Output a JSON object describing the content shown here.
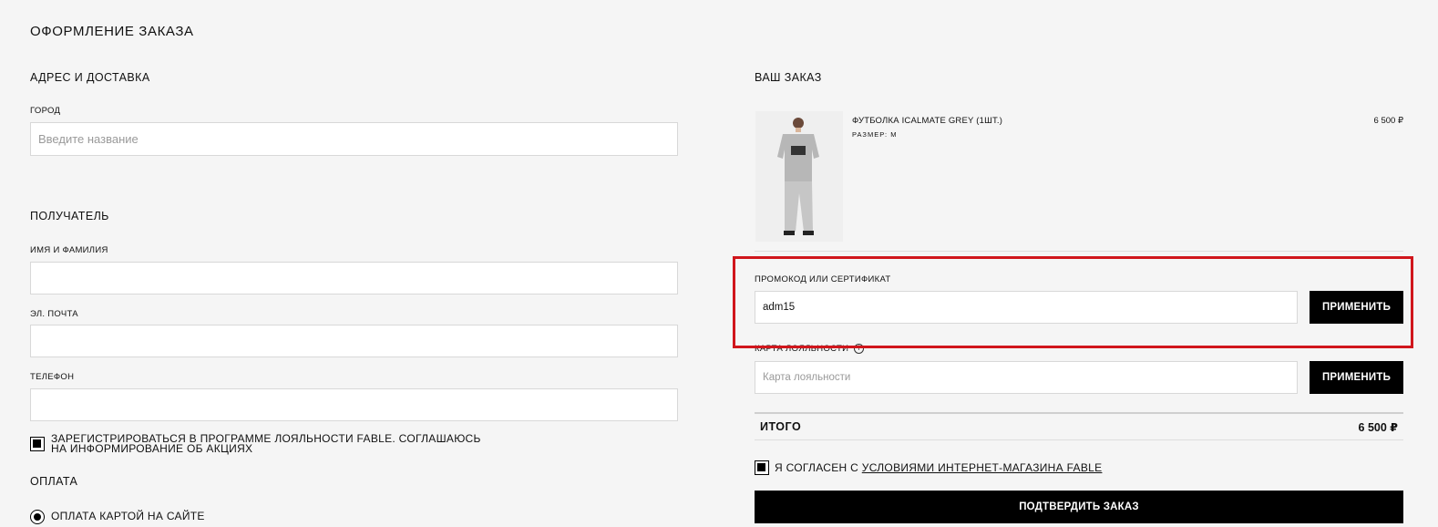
{
  "page_title": "ОФОРМЛЕНИЕ ЗАКАЗА",
  "delivery": {
    "heading": "АДРЕС И ДОСТАВКА",
    "city_label": "ГОРОД",
    "city_placeholder": "Введите название",
    "city_value": ""
  },
  "recipient": {
    "heading": "ПОЛУЧАТЕЛЬ",
    "name_label": "ИМЯ И ФАМИЛИЯ",
    "name_value": "",
    "email_label": "ЭЛ. ПОЧТА",
    "email_value": "",
    "phone_label": "ТЕЛЕФОН",
    "phone_value": "",
    "loyalty_checkbox_line1": "ЗАРЕГИСТРИРОВАТЬСЯ В ПРОГРАММЕ ЛОЯЛЬНОСТИ FABLE. СОГЛАШАЮСЬ",
    "loyalty_checkbox_line2": "НА ИНФОРМИРОВАНИЕ ОБ АКЦИЯХ",
    "loyalty_checked": true
  },
  "payment": {
    "heading": "ОПЛАТА",
    "option_label": "ОПЛАТА КАРТОЙ НА САЙТЕ",
    "selected": true
  },
  "order": {
    "heading": "ВАШ ЗАКАЗ",
    "item": {
      "name": "ФУТБОЛКА ICALMATE GREY (1ШТ.)",
      "size": "РАЗМЕР: M",
      "price": "6 500 ₽"
    },
    "promo_label": "ПРОМОКОД ИЛИ СЕРТИФИКАТ",
    "promo_value": "adm15",
    "promo_button": "ПРИМЕНИТЬ",
    "loyalty_label": "КАРТА ЛОЯЛЬНОСТИ",
    "loyalty_placeholder": "Карта лояльности",
    "loyalty_button": "ПРИМЕНИТЬ",
    "total_label": "ИТОГО",
    "total_value": "6 500 ₽",
    "agree_prefix": "Я СОГЛАСЕН С",
    "agree_link": "УСЛОВИЯМИ ИНТЕРНЕТ-МАГАЗИНА FABLE",
    "agree_checked": true,
    "confirm_button": "ПОДТВЕРДИТЬ ЗАКАЗ"
  },
  "colors": {
    "background": "#f5f5f5",
    "button": "#000000",
    "highlight": "#d0161c"
  }
}
